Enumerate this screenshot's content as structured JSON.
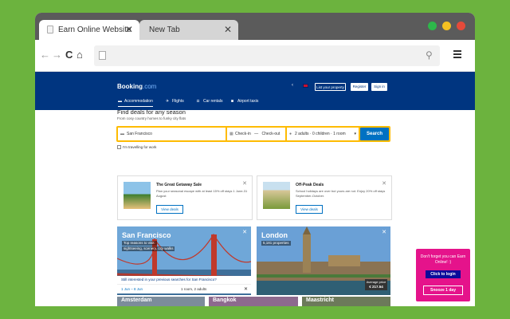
{
  "browser": {
    "tabs": [
      {
        "label": "Earn Online Website"
      },
      {
        "label": "New Tab"
      }
    ],
    "window_dots": [
      "#2db74a",
      "#f5c022",
      "#e54a3a"
    ],
    "address": ""
  },
  "booking": {
    "logo_main": "Booking",
    "logo_suffix": ".com",
    "header_buttons": {
      "list": "List your property",
      "register": "Register",
      "signin": "Sign in"
    },
    "nav": [
      {
        "label": "Accommodation",
        "icon": "bed-icon"
      },
      {
        "label": "Flights",
        "icon": "plane-icon"
      },
      {
        "label": "Car rentals",
        "icon": "car-icon"
      },
      {
        "label": "Airport taxis",
        "icon": "taxi-icon"
      }
    ],
    "search": {
      "title": "Find deals for any season",
      "subtitle": "From cosy country homes to funky city flats",
      "destination": "San Francisco",
      "checkin": "Check-in",
      "checkout": "Check-out",
      "guests": "2 adults · 0 children · 1 room",
      "button": "Search",
      "work_label": "I'm travelling for work"
    },
    "deals": [
      {
        "title": "The Great Getaway Sale",
        "desc": "Plan your seasonal escape with at least 15% off stays 1 June-31 August",
        "button": "View deals"
      },
      {
        "title": "Off-Peak Deals",
        "desc": "School holidays are over but yours are not. Enjoy 20% off stays September-October.",
        "button": "View deals"
      }
    ],
    "destinations": [
      {
        "name": "San Francisco",
        "sub1": "Top reasons to visit:",
        "sub2": "sightseeing, scenery, city walks"
      },
      {
        "name": "London",
        "sub1": "5,181 properties",
        "sub2": ""
      }
    ],
    "sf_prompt": "Still interested in your previous searches for San Francisco?",
    "sf_dates": "1 Jun – 8 Jun",
    "sf_guests": "1 room, 2 adults",
    "london_price_label": "Average price",
    "london_price": "€ 217.54",
    "thumbs": [
      "Amsterdam",
      "Bangkok",
      "Maastricht"
    ]
  },
  "popup": {
    "message": "Don't forget you can Earn Online! :)",
    "login": "Click to login",
    "snooze": "Snooze 1 day"
  }
}
